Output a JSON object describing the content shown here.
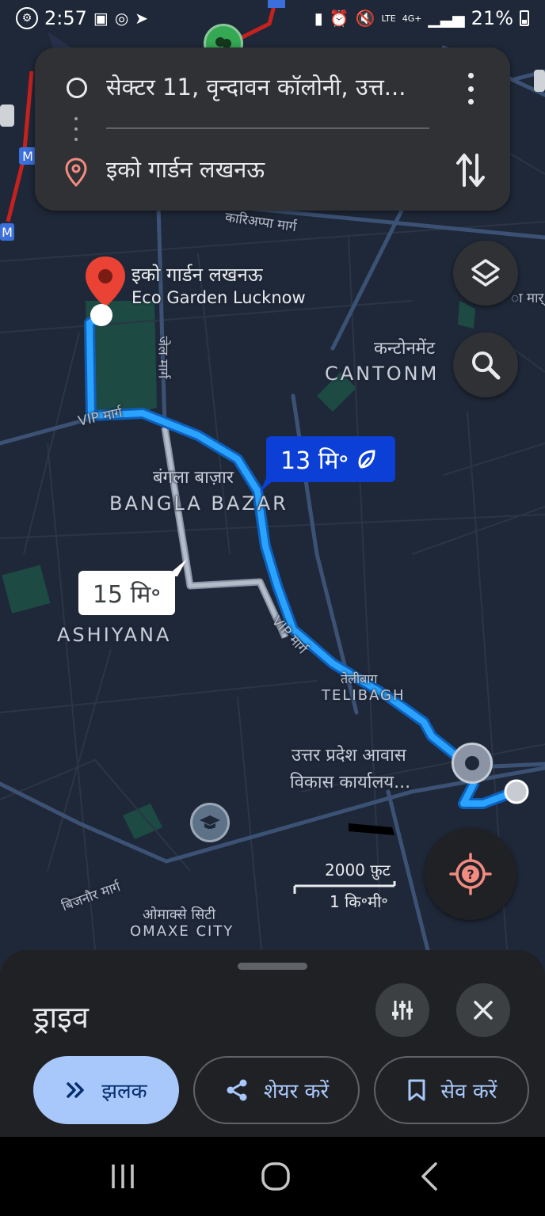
{
  "status_bar": {
    "time": "2:57",
    "network": "LTE",
    "network_gen": "4G+",
    "battery": "21%"
  },
  "directions": {
    "origin": "सेक्टर 11, वृन्दावन कॉलोनी, उत्त...",
    "destination": "इको गार्डन लखनऊ"
  },
  "map": {
    "destination_pin": {
      "name_hi": "इको गार्डन लखनऊ",
      "name_en": "Eco Garden Lucknow"
    },
    "area_labels": {
      "bangla_bazar_hi": "बंगला बाज़ार",
      "bangla_bazar_en": "BANGLA BAZAR",
      "ashiyana_en": "ASHIYANA",
      "telibagh_hi": "तेलीबाग",
      "telibagh_en": "TELIBAGH",
      "cantonment_hi": "कन्टोनमेंट",
      "cantonment_en": "CANTONM",
      "omaxe_hi": "ओमाक्से सिटी",
      "omaxe_en": "OMAXE CITY",
      "up_awas": "उत्तर प्रदेश आवास",
      "up_awas_2": "विकास कार्यालय..."
    },
    "road_labels": {
      "kariappa": "कारिअप्पा मार्ग",
      "vip_1": "VIP मार्ग",
      "vip_2": "VIP मार्ग",
      "jail": "जेल मार्ग",
      "bijnor": "बिजनौर मार्ग",
      "edge": "ा मार्"
    },
    "eta_primary": "13 मि॰",
    "eta_alternate": "15 मि॰",
    "scale_imperial": "2000 फ़ुट",
    "scale_metric": "1 कि॰मी॰"
  },
  "sheet": {
    "title": "ड्राइव",
    "buttons": {
      "preview": "झलक",
      "share": "शेयर करें",
      "save": "सेव करें"
    }
  },
  "colors": {
    "map_bg": "#1f2838",
    "route_blue": "#29a3ff",
    "eta_blue": "#0b3fd6",
    "card_bg": "#303134",
    "sheet_bg": "#202124",
    "accent_light_blue": "#a8c7fa",
    "pin_red": "#ea4335"
  },
  "icons": [
    "gallery-icon",
    "whatsapp-icon",
    "telegram-icon",
    "layers-icon",
    "search-icon",
    "location-help-icon",
    "tune-icon",
    "close-icon",
    "share-icon",
    "bookmark-icon",
    "recents-icon",
    "home-icon",
    "back-icon"
  ]
}
